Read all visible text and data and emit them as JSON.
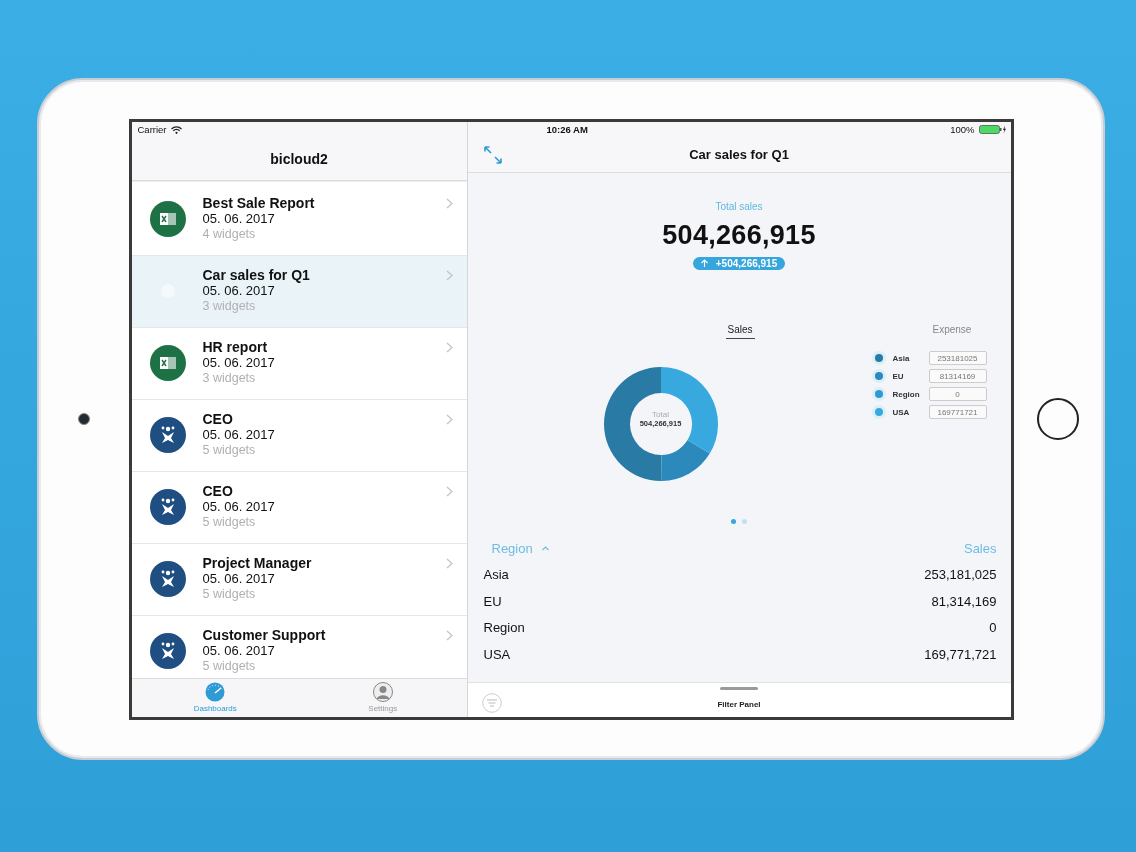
{
  "status_bar": {
    "carrier": "Carrier",
    "time": "10:26 AM",
    "battery": "100%"
  },
  "sidebar": {
    "title": "bicloud2",
    "items": [
      {
        "title": "Best Sale Report",
        "date": "05. 06. 2017",
        "subtitle": "4 widgets",
        "kind": "excel",
        "selected": false
      },
      {
        "title": "Car sales for Q1",
        "date": "05. 06. 2017",
        "subtitle": "3 widgets",
        "kind": "generic",
        "selected": true
      },
      {
        "title": "HR report",
        "date": "05. 06. 2017",
        "subtitle": "3 widgets",
        "kind": "excel",
        "selected": false
      },
      {
        "title": "CEO",
        "date": "05. 06. 2017",
        "subtitle": "5 widgets",
        "kind": "figure",
        "selected": false
      },
      {
        "title": "CEO",
        "date": "05. 06. 2017",
        "subtitle": "5 widgets",
        "kind": "figure",
        "selected": false
      },
      {
        "title": "Project Manager",
        "date": "05. 06. 2017",
        "subtitle": "5 widgets",
        "kind": "figure",
        "selected": false
      },
      {
        "title": "Customer Support",
        "date": "05. 06. 2017",
        "subtitle": "5 widgets",
        "kind": "figure",
        "selected": false
      }
    ]
  },
  "tab_bar": [
    {
      "label": "Dashboards",
      "kind": "dashboards",
      "selected": true
    },
    {
      "label": "Settings",
      "kind": "settings",
      "selected": false
    }
  ],
  "detail": {
    "title": "Car sales for Q1",
    "kpi": {
      "label": "Total sales",
      "value": "504,266,915",
      "change": "+504,266,915"
    },
    "chart_tabs": [
      {
        "label": "Sales",
        "selected": true
      },
      {
        "label": "Expense",
        "selected": false
      }
    ],
    "chart": {
      "center_label": "Total",
      "center_value": "504,266,915",
      "chart_data": {
        "type": "donut",
        "categories": [
          "Asia",
          "EU",
          "Region",
          "USA"
        ],
        "values": [
          50.21,
          16.12,
          0,
          33.67
        ]
      }
    },
    "legend": [
      {
        "value": "253181025",
        "color": "#2a7aa6"
      },
      {
        "value": "81314169",
        "color": "#2c89bb"
      },
      {
        "value": "0",
        "color": "#3399cc"
      },
      {
        "value": "169771721",
        "color": "#38a9de"
      }
    ],
    "pager": [
      {
        "selected": true
      },
      {
        "selected": false
      }
    ],
    "table": {
      "columns": [
        {
          "label": "Region",
          "sorted": true
        },
        {
          "label": "Sales",
          "sorted": false
        }
      ],
      "rows": [
        [
          "Asia",
          "253,181,025"
        ],
        [
          "EU",
          "81,314,169"
        ],
        [
          "Region",
          "0"
        ],
        [
          "USA",
          "169,771,721"
        ]
      ]
    },
    "filter_panel": {
      "label": "Filter Panel"
    }
  }
}
